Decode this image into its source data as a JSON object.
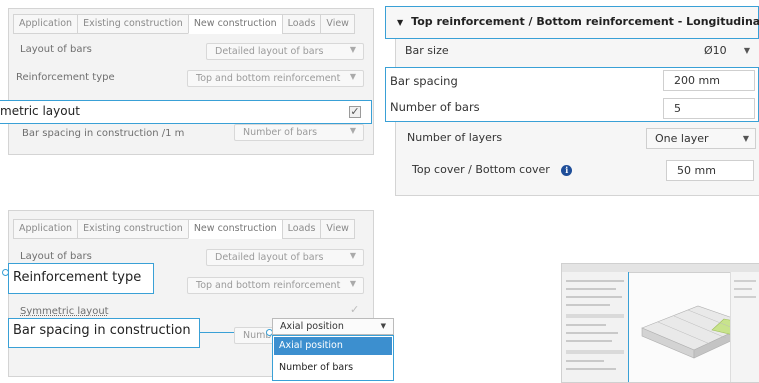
{
  "panel1": {
    "tabs": [
      "Application",
      "Existing construction",
      "New construction",
      "Loads",
      "View"
    ],
    "layout_label": "Layout of bars",
    "layout_value": "Detailed layout of bars",
    "reinf_label": "Reinforcement type",
    "reinf_value": "Top and bottom reinforcement",
    "symmetric_label": "metric layout",
    "spacing_label": "Bar spacing in construction /1 m",
    "spacing_value": "Number of bars"
  },
  "panel2": {
    "header": "Top reinforcement / Bottom reinforcement - Longitudinal",
    "bar_size_label": "Bar size",
    "bar_size_value": "Ø10",
    "bar_spacing_label": "Bar spacing",
    "bar_spacing_value": "200 mm",
    "num_bars_label": "Number of bars",
    "num_bars_value": "5",
    "layers_label": "Number of layers",
    "layers_value": "One layer",
    "cover_label": "Top cover / Bottom cover",
    "cover_value": "50 mm"
  },
  "panel3": {
    "tabs": [
      "Application",
      "Existing construction",
      "New construction",
      "Loads",
      "View"
    ],
    "layout_label": "Layout of bars",
    "layout_value": "Detailed layout of bars",
    "reinf_label": "Reinforcement type",
    "reinf_value": "Top and bottom reinforcement",
    "symmetric_label": "Symmetric layout",
    "spacing_label": "Bar spacing in construction",
    "spacing_value": "Numb",
    "dropdown_selected": "Axial position",
    "dropdown_options": [
      "Axial position",
      "Number of bars"
    ]
  },
  "colors": {
    "accent": "#39a0d6",
    "selected_option": "#3c8fcf",
    "info_icon": "#1f4e99"
  }
}
